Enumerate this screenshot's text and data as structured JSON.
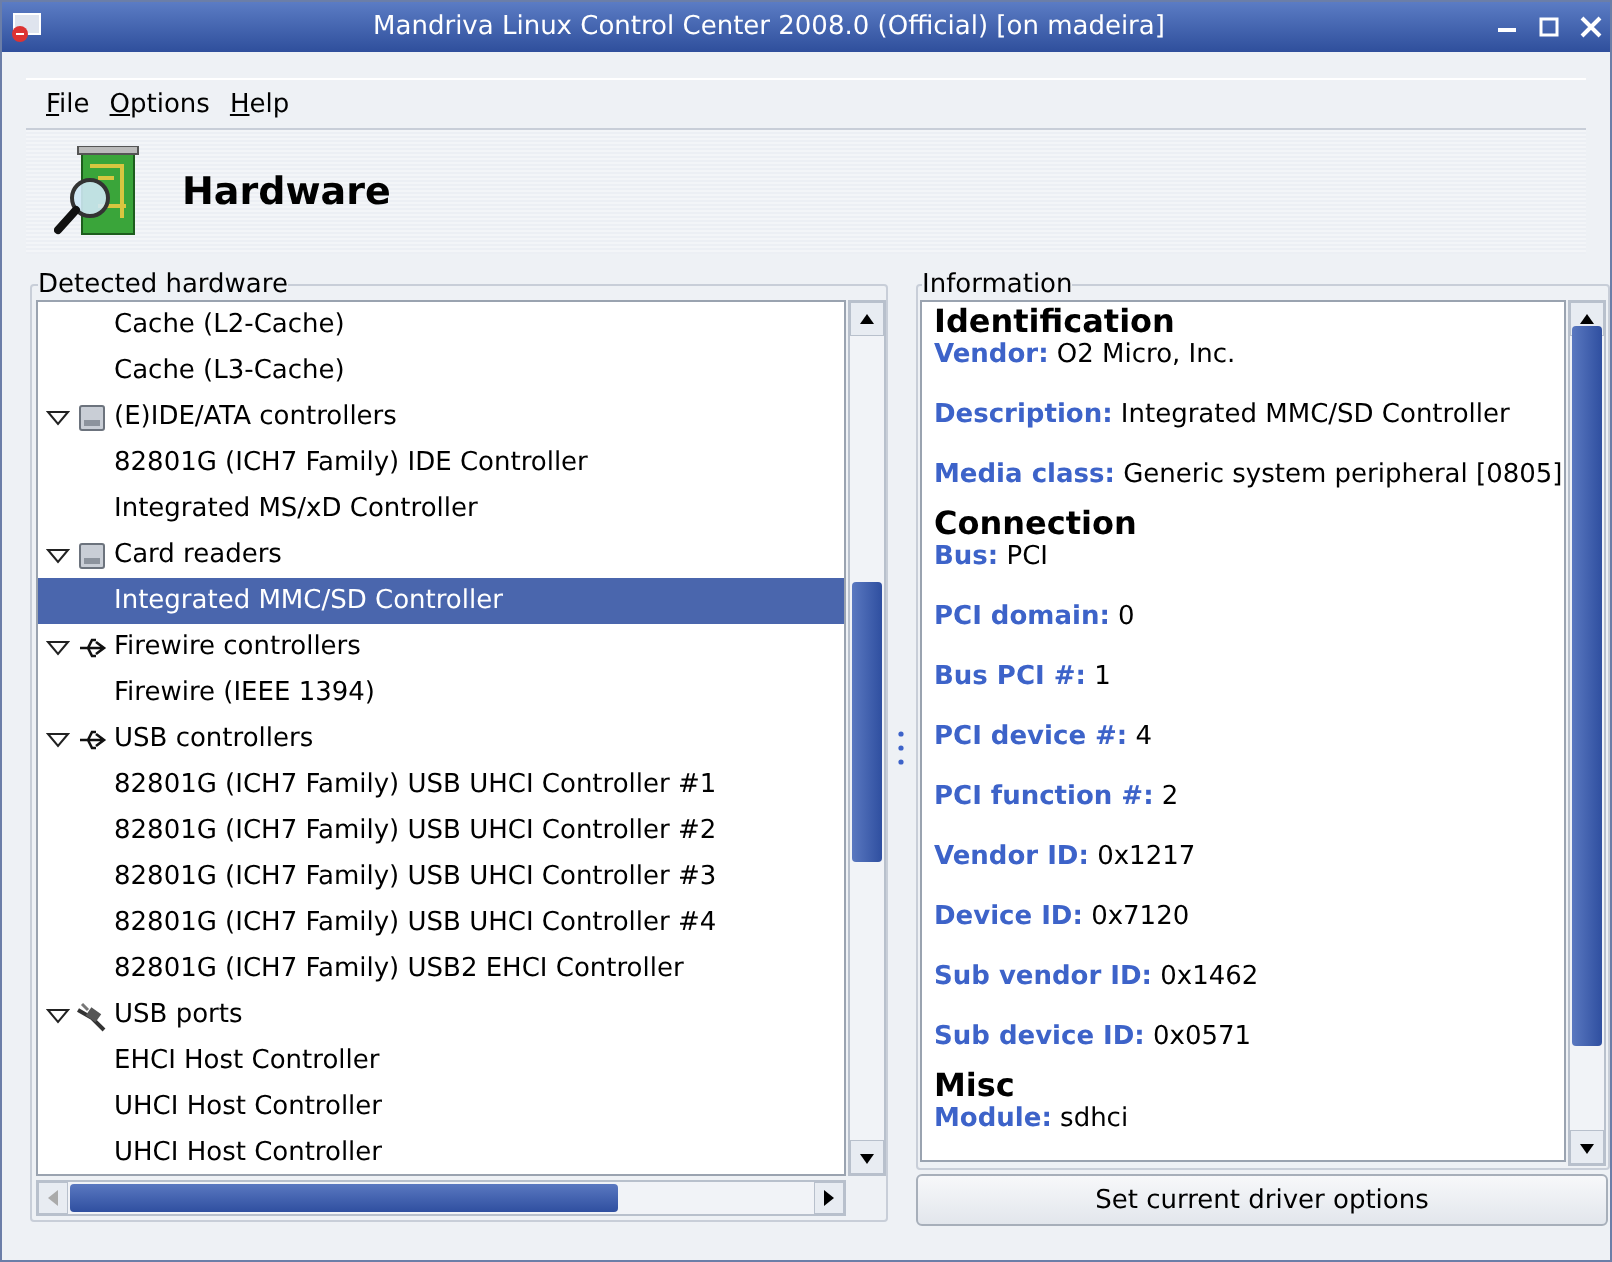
{
  "window": {
    "title": "Mandriva Linux Control Center 2008.0 (Official) [on madeira]"
  },
  "menu": [
    "File",
    "Options",
    "Help"
  ],
  "header": {
    "title": "Hardware"
  },
  "tree": {
    "legend": "Detected hardware",
    "items": [
      {
        "children": [
          {
            "label": "Cache (L2-Cache)",
            "selected": false
          },
          {
            "label": "Cache (L3-Cache)",
            "selected": false
          }
        ]
      },
      {
        "label": "(E)IDE/ATA controllers",
        "kind": "drive",
        "expanded": true,
        "selected": false,
        "children": [
          {
            "label": "82801G (ICH7 Family) IDE Controller",
            "selected": false
          },
          {
            "label": "Integrated MS/xD Controller",
            "selected": false
          }
        ]
      },
      {
        "label": "Card readers",
        "kind": "drive",
        "expanded": true,
        "selected": false,
        "children": [
          {
            "label": "Integrated MMC/SD Controller",
            "selected": true
          }
        ]
      },
      {
        "label": "Firewire controllers",
        "kind": "usb",
        "expanded": true,
        "selected": false,
        "children": [
          {
            "label": "Firewire (IEEE 1394)",
            "selected": false
          }
        ]
      },
      {
        "label": "USB controllers",
        "kind": "usb",
        "expanded": true,
        "selected": false,
        "children": [
          {
            "label": "82801G (ICH7 Family) USB UHCI Controller #1",
            "selected": false
          },
          {
            "label": "82801G (ICH7 Family) USB UHCI Controller #2",
            "selected": false
          },
          {
            "label": "82801G (ICH7 Family) USB UHCI Controller #3",
            "selected": false
          },
          {
            "label": "82801G (ICH7 Family) USB UHCI Controller #4",
            "selected": false
          },
          {
            "label": "82801G (ICH7 Family) USB2 EHCI Controller",
            "selected": false
          }
        ]
      },
      {
        "label": "USB ports",
        "kind": "plug",
        "expanded": true,
        "selected": false,
        "children": [
          {
            "label": "EHCI Host Controller",
            "selected": false
          },
          {
            "label": "UHCI Host Controller",
            "selected": false
          },
          {
            "label": "UHCI Host Controller",
            "selected": false
          }
        ]
      }
    ]
  },
  "info": {
    "legend": "Information",
    "sections": [
      {
        "heading": "Identification",
        "fields": [
          {
            "label": "Vendor:",
            "value": "O2 Micro, Inc."
          },
          {
            "label": "Description:",
            "value": "Integrated MMC/SD Controller"
          },
          {
            "label": "Media class:",
            "value": "Generic system peripheral [0805]"
          }
        ]
      },
      {
        "heading": "Connection",
        "fields": [
          {
            "label": "Bus:",
            "value": "PCI"
          },
          {
            "label": "PCI domain:",
            "value": "0"
          },
          {
            "label": "Bus PCI #:",
            "value": "1"
          },
          {
            "label": "PCI device #:",
            "value": "4"
          },
          {
            "label": "PCI function #:",
            "value": "2"
          },
          {
            "label": "Vendor ID:",
            "value": "0x1217"
          },
          {
            "label": "Device ID:",
            "value": "0x7120"
          },
          {
            "label": "Sub vendor ID:",
            "value": "0x1462"
          },
          {
            "label": "Sub device ID:",
            "value": "0x0571"
          }
        ]
      },
      {
        "heading": "Misc",
        "fields": [
          {
            "label": "Module:",
            "value": "sdhci"
          }
        ]
      }
    ],
    "button": "Set current driver options"
  }
}
